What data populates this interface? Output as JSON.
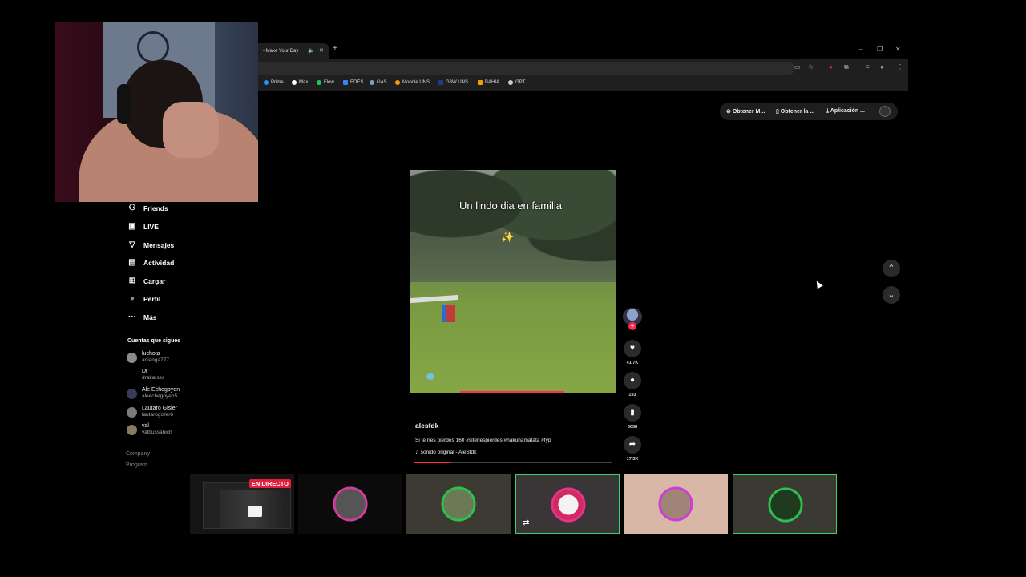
{
  "browser": {
    "tab_title": "- Make Your Day",
    "tab_audio_icon": "speaker-icon",
    "new_tab_label": "+",
    "window_controls": [
      "–",
      "❐",
      "✕"
    ],
    "bookmarks": [
      {
        "label": "Prime",
        "color": "#1a98ff"
      },
      {
        "label": "Max",
        "color": "#ffffff"
      },
      {
        "label": "Flow",
        "color": "#22c55e"
      },
      {
        "label": "EDES",
        "color": "#3b82f6"
      },
      {
        "label": "GAS",
        "color": "#7c9cbf"
      },
      {
        "label": "Moodle UNS",
        "color": "#f59e0b"
      },
      {
        "label": "G3W UNS",
        "color": "#1e3a8a"
      },
      {
        "label": "BAHIA",
        "color": "#f59e0b"
      },
      {
        "label": "GPT",
        "color": "#cccccc"
      }
    ]
  },
  "getbar": {
    "item1": "Obtener M...",
    "item2": "Obtener la ...",
    "item3": "Aplicación ..."
  },
  "sidebar": {
    "nav": [
      {
        "label": "Friends",
        "icon": "friends-icon",
        "glyph": "⚇"
      },
      {
        "label": "LIVE",
        "icon": "live-icon",
        "glyph": "▣"
      },
      {
        "label": "Mensajes",
        "icon": "send-icon",
        "glyph": "▽"
      },
      {
        "label": "Actividad",
        "icon": "activity-icon",
        "glyph": "▤"
      },
      {
        "label": "Cargar",
        "icon": "upload-icon",
        "glyph": "⊞"
      },
      {
        "label": "Perfil",
        "icon": "profile-avatar-icon",
        "glyph": "●"
      },
      {
        "label": "Más",
        "icon": "more-icon",
        "glyph": "···"
      }
    ],
    "following_title": "Cuentas que sigues",
    "following": [
      {
        "name": "luchota",
        "handle": "anianga777"
      },
      {
        "name": "Dr",
        "handle": "drakarsss"
      },
      {
        "name": "Ale Echegoyen",
        "handle": "aleechegoyen5"
      },
      {
        "name": "Lautaro Gisler",
        "handle": "lautarogisler6"
      },
      {
        "name": "val",
        "handle": "valbussanich"
      }
    ],
    "footer": [
      "Company",
      "Program"
    ]
  },
  "video": {
    "caption": "Un lindo dia en familia",
    "sparkle": "✨",
    "author": "alesfdk",
    "description": "Si te ríes pierdes 160 #siteriespierdes #hakunamatata #fyp",
    "sound": "sonido original - AleSfdk",
    "progress_fraction": 0.18
  },
  "actions": {
    "follow_plus": "+",
    "likes": "41.7K",
    "comments": "193",
    "saves": "6058",
    "shares": "17.3K"
  },
  "navigation": {
    "up": "⌃",
    "down": "⌄"
  },
  "stream": {
    "live_badge": "EN DIRECTO"
  }
}
